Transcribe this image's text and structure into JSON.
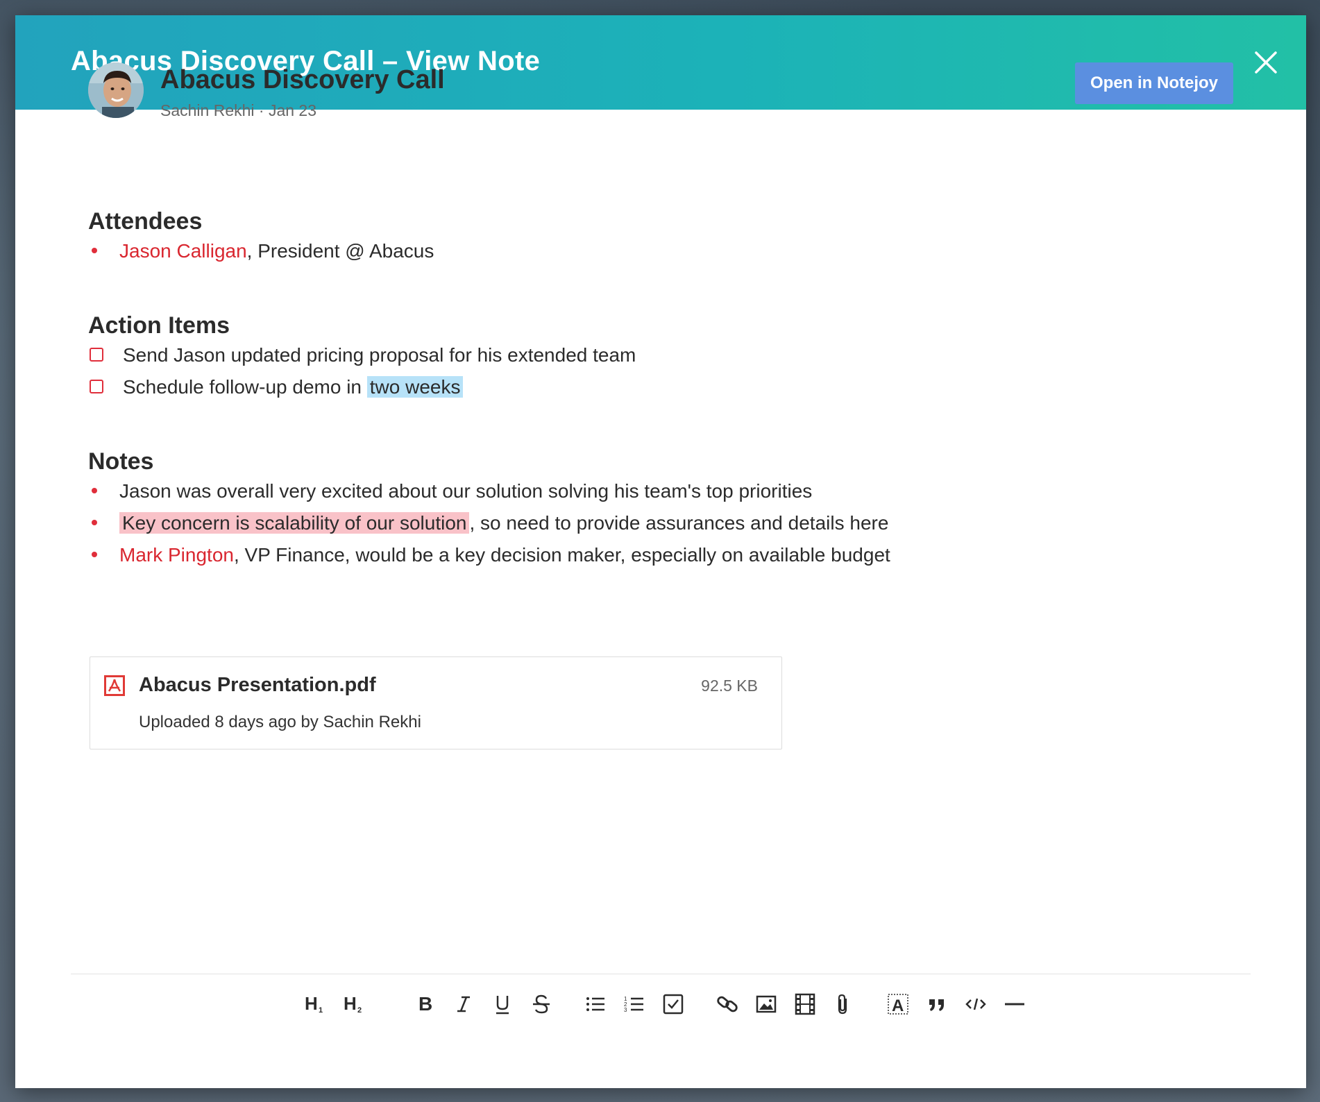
{
  "modal": {
    "title": "Abacus Discovery Call – View Note",
    "close_icon": "close-icon"
  },
  "note": {
    "title": "Abacus Discovery Call",
    "author": "Sachin Rekhi",
    "date": "Jan 23",
    "meta": "Sachin Rekhi · Jan 23",
    "open_button": "Open in Notejoy"
  },
  "sections": {
    "attendees": {
      "heading": "Attendees",
      "items": [
        {
          "mention": "Jason Calligan",
          "text": ", President @ Abacus"
        }
      ]
    },
    "action_items": {
      "heading": "Action Items",
      "items": [
        {
          "text": "Send Jason updated pricing proposal for his extended team",
          "checked": false
        },
        {
          "text": "Schedule follow-up demo in ",
          "highlight": "two weeks",
          "checked": false
        }
      ]
    },
    "notes": {
      "heading": "Notes",
      "items": [
        {
          "text": "Jason was overall very excited about our solution solving his team's top priorities"
        },
        {
          "highlight": "Key concern is scalability of our solution",
          "text": ", so need to provide assurances and details here"
        },
        {
          "mention": "Mark Pington",
          "text": ", VP Finance, would be a key decision maker, especially on available budget"
        }
      ]
    }
  },
  "attachment": {
    "name": "Abacus Presentation.pdf",
    "size": "92.5 KB",
    "subtitle": "Uploaded 8 days ago by Sachin Rekhi",
    "icon": "pdf-icon"
  },
  "toolbar": {
    "buttons": [
      "heading-1",
      "heading-2",
      "bold",
      "italic",
      "underline",
      "strikethrough",
      "bulleted-list",
      "numbered-list",
      "checklist",
      "link",
      "image",
      "video",
      "attachment",
      "clear-format",
      "quote",
      "code",
      "horizontal-rule"
    ]
  },
  "colors": {
    "header_start": "#22a3bd",
    "header_end": "#22c0a6",
    "mention": "#d9262f",
    "button": "#5b8fe0",
    "highlight_blue": "#b7e2f8",
    "highlight_pink": "#f9c2c8"
  }
}
